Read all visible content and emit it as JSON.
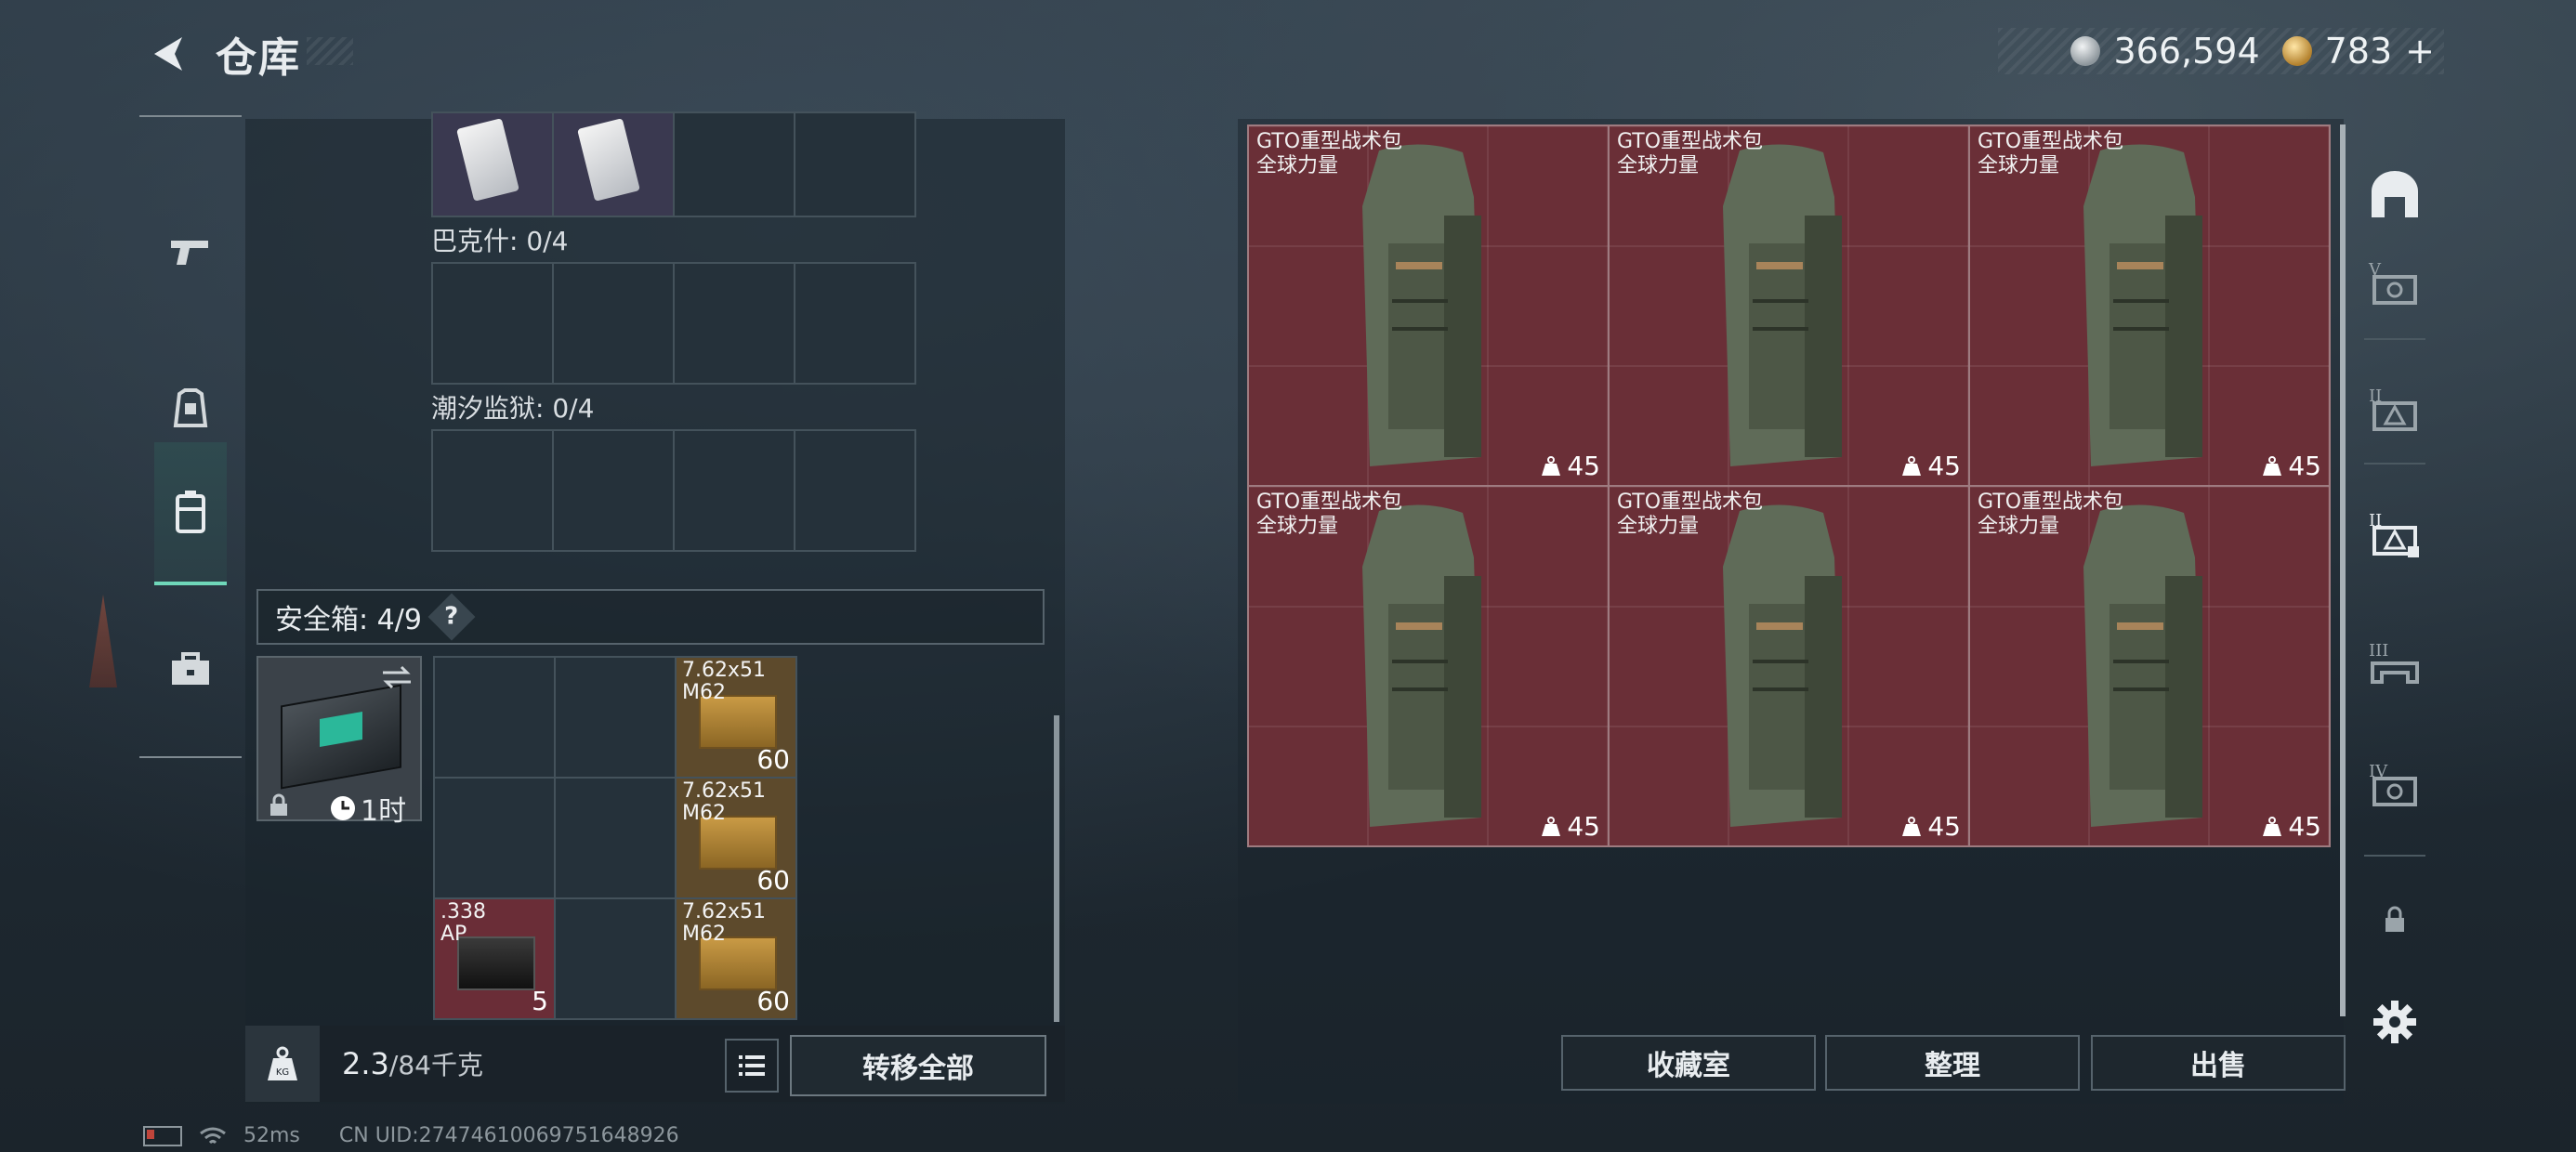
{
  "header": {
    "title": "仓库",
    "currency": [
      {
        "icon": "silver-coin-icon",
        "value": "366,594"
      },
      {
        "icon": "gold-coin-icon",
        "value": "783"
      }
    ],
    "add_label": "+"
  },
  "left_rail": {
    "items": [
      {
        "icon": "pistol-icon",
        "active": false
      },
      {
        "icon": "armor-icon",
        "active": false
      },
      {
        "icon": "backpack-icon",
        "active": true
      },
      {
        "icon": "briefcase-icon",
        "active": false
      }
    ]
  },
  "slots": [
    {
      "label": "巴克什: 0/4"
    },
    {
      "label": "潮汐监狱: 0/4"
    }
  ],
  "safebox": {
    "header": "安全箱:  4/9",
    "help": "?",
    "timer": "1时",
    "swap_icon": "swap-icon",
    "items": [
      {
        "name": "7.62x51\nM62",
        "qty": "60"
      },
      {
        "name": "7.62x51\nM62",
        "qty": "60"
      },
      {
        "name": ".338\nAP",
        "qty": "5"
      },
      {
        "name": "7.62x51\nM62",
        "qty": "60"
      }
    ]
  },
  "weight": {
    "current": "2.3",
    "max": "/84千克",
    "icon_label": "KG"
  },
  "buttons": {
    "transfer_all": "转移全部",
    "collection": "收藏室",
    "sort": "整理",
    "sell": "出售"
  },
  "storage": {
    "items": [
      {
        "name": "GTO重型战术包",
        "subtitle": "全球力量",
        "weight": "45"
      },
      {
        "name": "GTO重型战术包",
        "subtitle": "全球力量",
        "weight": "45"
      },
      {
        "name": "GTO重型战术包",
        "subtitle": "全球力量",
        "weight": "45"
      },
      {
        "name": "GTO重型战术包",
        "subtitle": "全球力量",
        "weight": "45"
      },
      {
        "name": "GTO重型战术包",
        "subtitle": "全球力量",
        "weight": "45"
      },
      {
        "name": "GTO重型战术包",
        "subtitle": "全球力量",
        "weight": "45"
      }
    ]
  },
  "right_rail": {
    "items": [
      {
        "icon": "home-storage-icon"
      },
      {
        "icon": "storage-v-icon",
        "tier": "V"
      },
      {
        "icon": "storage-ii-icon",
        "tier": "II"
      },
      {
        "icon": "storage-ii-active-icon",
        "tier": "II"
      },
      {
        "icon": "storage-iii-icon",
        "tier": "III"
      },
      {
        "icon": "storage-iv-icon",
        "tier": "IV"
      },
      {
        "icon": "lock-icon"
      },
      {
        "icon": "gear-icon"
      }
    ]
  },
  "status": {
    "ping": "52ms",
    "uid": "CN UID:27474610069751648926"
  }
}
